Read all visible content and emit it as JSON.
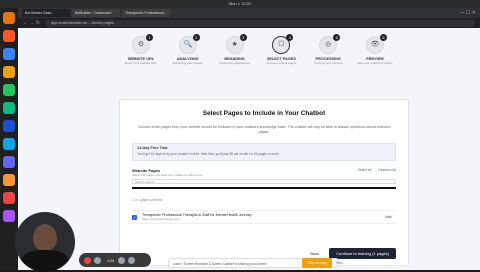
{
  "system": {
    "clock": "Mon 1 12:01"
  },
  "browser": {
    "tabs": [
      "Bot Builder Dash...",
      "BotBuilder - Dashboard",
      "Therapeutic Professional..."
    ],
    "url": "app.chatbotbuilder.ai/..../select-pages"
  },
  "steps": [
    {
      "title": "WEBSITE URL",
      "sub": "Enter your website URL",
      "num": "1",
      "icon": "⚙"
    },
    {
      "title": "ANALYZING",
      "sub": "Analyzing your content",
      "num": "2",
      "icon": "🔍"
    },
    {
      "title": "BRANDING",
      "sub": "Customize appearance",
      "num": "3",
      "icon": "★"
    },
    {
      "title": "SELECT PAGES",
      "sub": "Choose content pages",
      "num": "4",
      "icon": "☐"
    },
    {
      "title": "PROCESSING",
      "sub": "Process your content",
      "num": "5",
      "icon": "◎"
    },
    {
      "title": "PREVIEW",
      "sub": "See your chatbot in action",
      "num": "6",
      "icon": "👁"
    }
  ],
  "card": {
    "title": "Select Pages to Include in Your Chatbot",
    "intro": "Choose which pages from your website should be included in your chatbot's knowledge base. The chatbot will only be able to answer questions about selected pages.",
    "trial_title": "14-Day Free Trial",
    "trial_body": "You'll get 14 days to try your chatbot for free. After that, you'll pay $5 per month for 25 pages or more.",
    "web_pages_label": "Website Pages",
    "web_pages_sub": "Select the pages you want your chatbot to learn from",
    "select_all": "Select all",
    "deselect_all": "Deselect All",
    "search_placeholder": "Search pages...",
    "count_text": "1 of 1 pages selected",
    "page_title": "Therapeutic Professional Therapist & Staff for Mental Health Journey",
    "page_url": "https://example-therapy.com",
    "page_tag": "Main",
    "back": "Back",
    "continue": "Continue to training (1 pages)"
  },
  "share": {
    "text": "Loom • Screen Recorder & Screen Capture is sharing your screen.",
    "stop": "Stop sharing",
    "hide": "Hide"
  },
  "recorder": {
    "time": "1:51"
  }
}
